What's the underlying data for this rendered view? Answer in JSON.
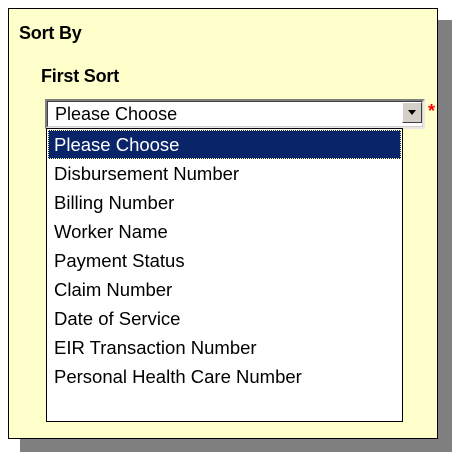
{
  "sort_panel": {
    "title": "Sort By",
    "first_sort": {
      "label": "First Sort",
      "selected_value": "Please Choose",
      "required_marker": "*",
      "options": [
        "Please Choose",
        "Disbursement Number",
        "Billing Number",
        "Worker Name",
        "Payment Status",
        "Claim Number",
        "Date of Service",
        "EIR Transaction Number",
        "Personal Health Care Number"
      ],
      "highlighted_index": 0
    }
  },
  "colors": {
    "panel_background": "#ffffcc",
    "selection_background": "#0a246a",
    "required_marker": "#ff0000"
  },
  "icons": {
    "dropdown_arrow": "chevron-down-icon"
  }
}
